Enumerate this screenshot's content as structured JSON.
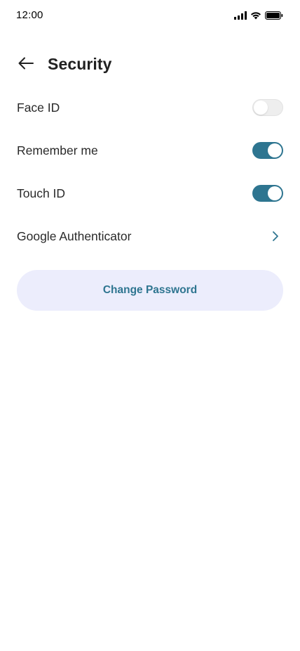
{
  "status_bar": {
    "time": "12:00",
    "icons": [
      "signal-icon",
      "wifi-icon",
      "battery-icon"
    ]
  },
  "header": {
    "back_icon": "arrow-left-icon",
    "title": "Security"
  },
  "settings": [
    {
      "label": "Face ID",
      "control": "toggle",
      "enabled": false
    },
    {
      "label": "Remember me",
      "control": "toggle",
      "enabled": true
    },
    {
      "label": "Touch ID",
      "control": "toggle",
      "enabled": true
    },
    {
      "label": "Google Authenticator",
      "control": "chevron",
      "icon": "chevron-right-icon"
    }
  ],
  "actions": {
    "change_password_label": "Change Password"
  },
  "colors": {
    "accent": "#2e7590",
    "toggle_off": "#eeeeee",
    "button_background": "#ecedfc",
    "text": "#212121"
  }
}
